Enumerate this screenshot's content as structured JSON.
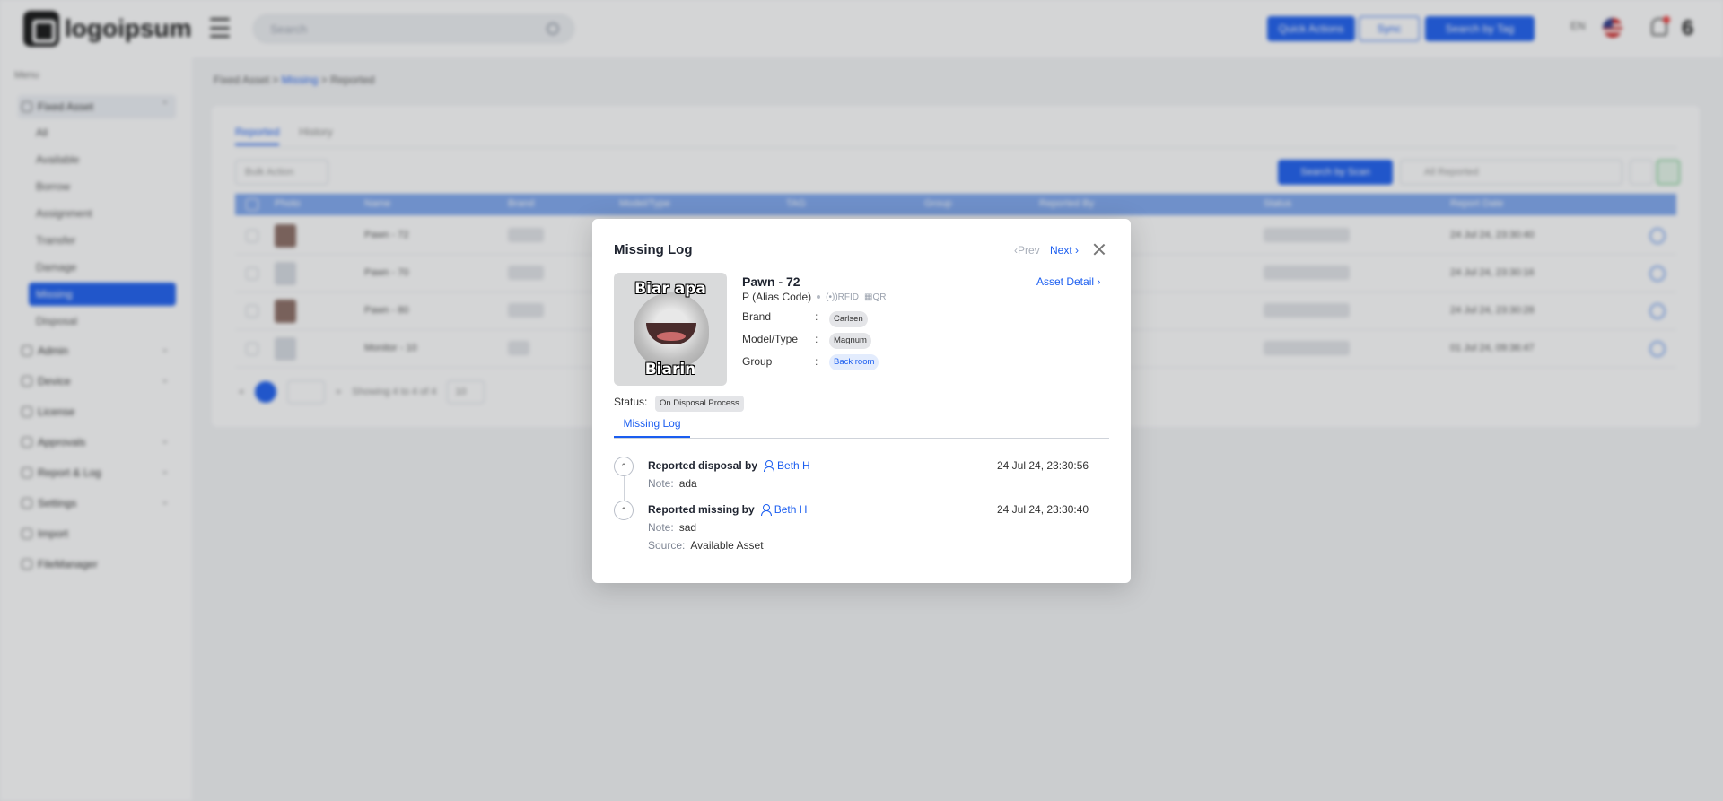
{
  "app": {
    "logo_text": "logoipsum",
    "search_placeholder": "Search",
    "top_buttons": [
      "Quick Actions",
      "Sync",
      "Search by Tag"
    ],
    "lang": "EN",
    "menu_caption": "Menu",
    "sidebar": [
      {
        "label": "Fixed Asset",
        "open": true
      },
      {
        "label": "Admin"
      },
      {
        "label": "Device"
      },
      {
        "label": "License"
      },
      {
        "label": "Approvals"
      },
      {
        "label": "Report & Log"
      },
      {
        "label": "Settings"
      },
      {
        "label": "Import"
      },
      {
        "label": "FileManager"
      }
    ],
    "sidebar_sub": [
      "All",
      "Available",
      "Borrow",
      "Assignment",
      "Transfer",
      "Damage",
      "Missing",
      "Disposal"
    ],
    "breadcrumb": [
      "Fixed Asset",
      "Missing",
      "Reported"
    ],
    "tabs": [
      "Reported",
      "History"
    ],
    "bulk_action": "Bulk Action",
    "scan_button": "Search by Scan",
    "filter_placeholder": "All Reported",
    "columns": [
      "Photo",
      "Name",
      "Brand",
      "Model/Type",
      "TAG",
      "Group",
      "Reported By",
      "Status",
      "Report Date"
    ],
    "rows": [
      {
        "name": "Pawn - 72",
        "date": "24 Jul 24, 23:30:40"
      },
      {
        "name": "Pawn - 70",
        "date": "24 Jul 24, 23:30:16"
      },
      {
        "name": "Pawn - 80",
        "date": "24 Jul 24, 23:30:28"
      },
      {
        "name": "Monitor - 10",
        "date": "01 Jul 24, 09:36:47"
      }
    ],
    "pager_text": "Showing 4 to 4 of 4",
    "page_size": "10"
  },
  "modal": {
    "title": "Missing Log",
    "prev": "‹Prev",
    "next": "Next ›",
    "photo_caption_top": "Biar apa",
    "photo_caption_bottom": "Biarin",
    "asset_name": "Pawn - 72",
    "alias": "P (Alias Code)",
    "tag_rfid": "(•))RFID",
    "tag_qr": "QR",
    "asset_detail": "Asset Detail ›",
    "fields": [
      {
        "label": "Brand",
        "value": "Carlsen",
        "style": "gray"
      },
      {
        "label": "Model/Type",
        "value": "Magnum",
        "style": "gray"
      },
      {
        "label": "Group",
        "value": "Back room",
        "style": "blue"
      }
    ],
    "status_label": "Status:",
    "status_value": "On Disposal Process",
    "tab": "Missing Log",
    "log": [
      {
        "title": "Reported disposal by",
        "user": "Beth H",
        "time": "24 Jul 24, 23:30:56",
        "note_label": "Note:",
        "note": "ada"
      },
      {
        "title": "Reported missing by",
        "user": "Beth H",
        "time": "24 Jul 24, 23:30:40",
        "note_label": "Note:",
        "note": "sad",
        "source_label": "Source:",
        "source": "Available Asset"
      }
    ]
  }
}
